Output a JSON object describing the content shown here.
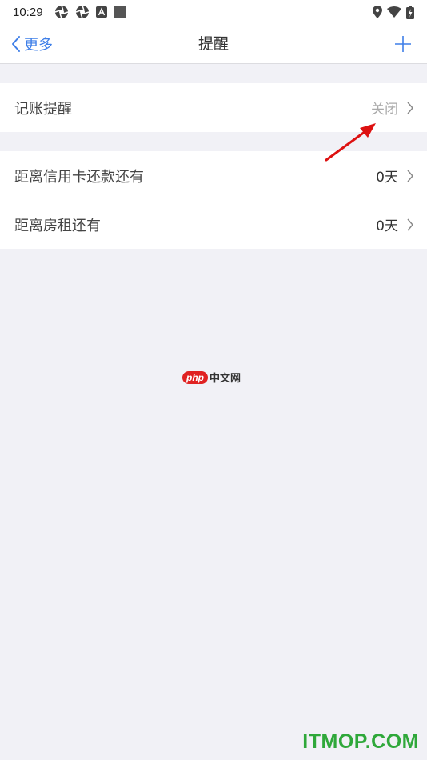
{
  "status_bar": {
    "time": "10:29",
    "icons_left": [
      "aperture-icon",
      "aperture-icon",
      "app-a-icon",
      "square-icon"
    ],
    "icons_right": [
      "location-icon",
      "wifi-icon",
      "battery-icon"
    ]
  },
  "nav": {
    "back_label": "更多",
    "title": "提醒",
    "accent_color": "#3f7fe8"
  },
  "groups": [
    {
      "rows": [
        {
          "label": "记账提醒",
          "value": "关闭"
        }
      ]
    },
    {
      "rows": [
        {
          "label": "距离信用卡还款还有",
          "value": "0天"
        },
        {
          "label": "距离房租还有",
          "value": "0天"
        }
      ]
    }
  ],
  "watermarks": {
    "php_badge": "php",
    "php_text": "中文网",
    "site": "ITMOP.COM"
  }
}
